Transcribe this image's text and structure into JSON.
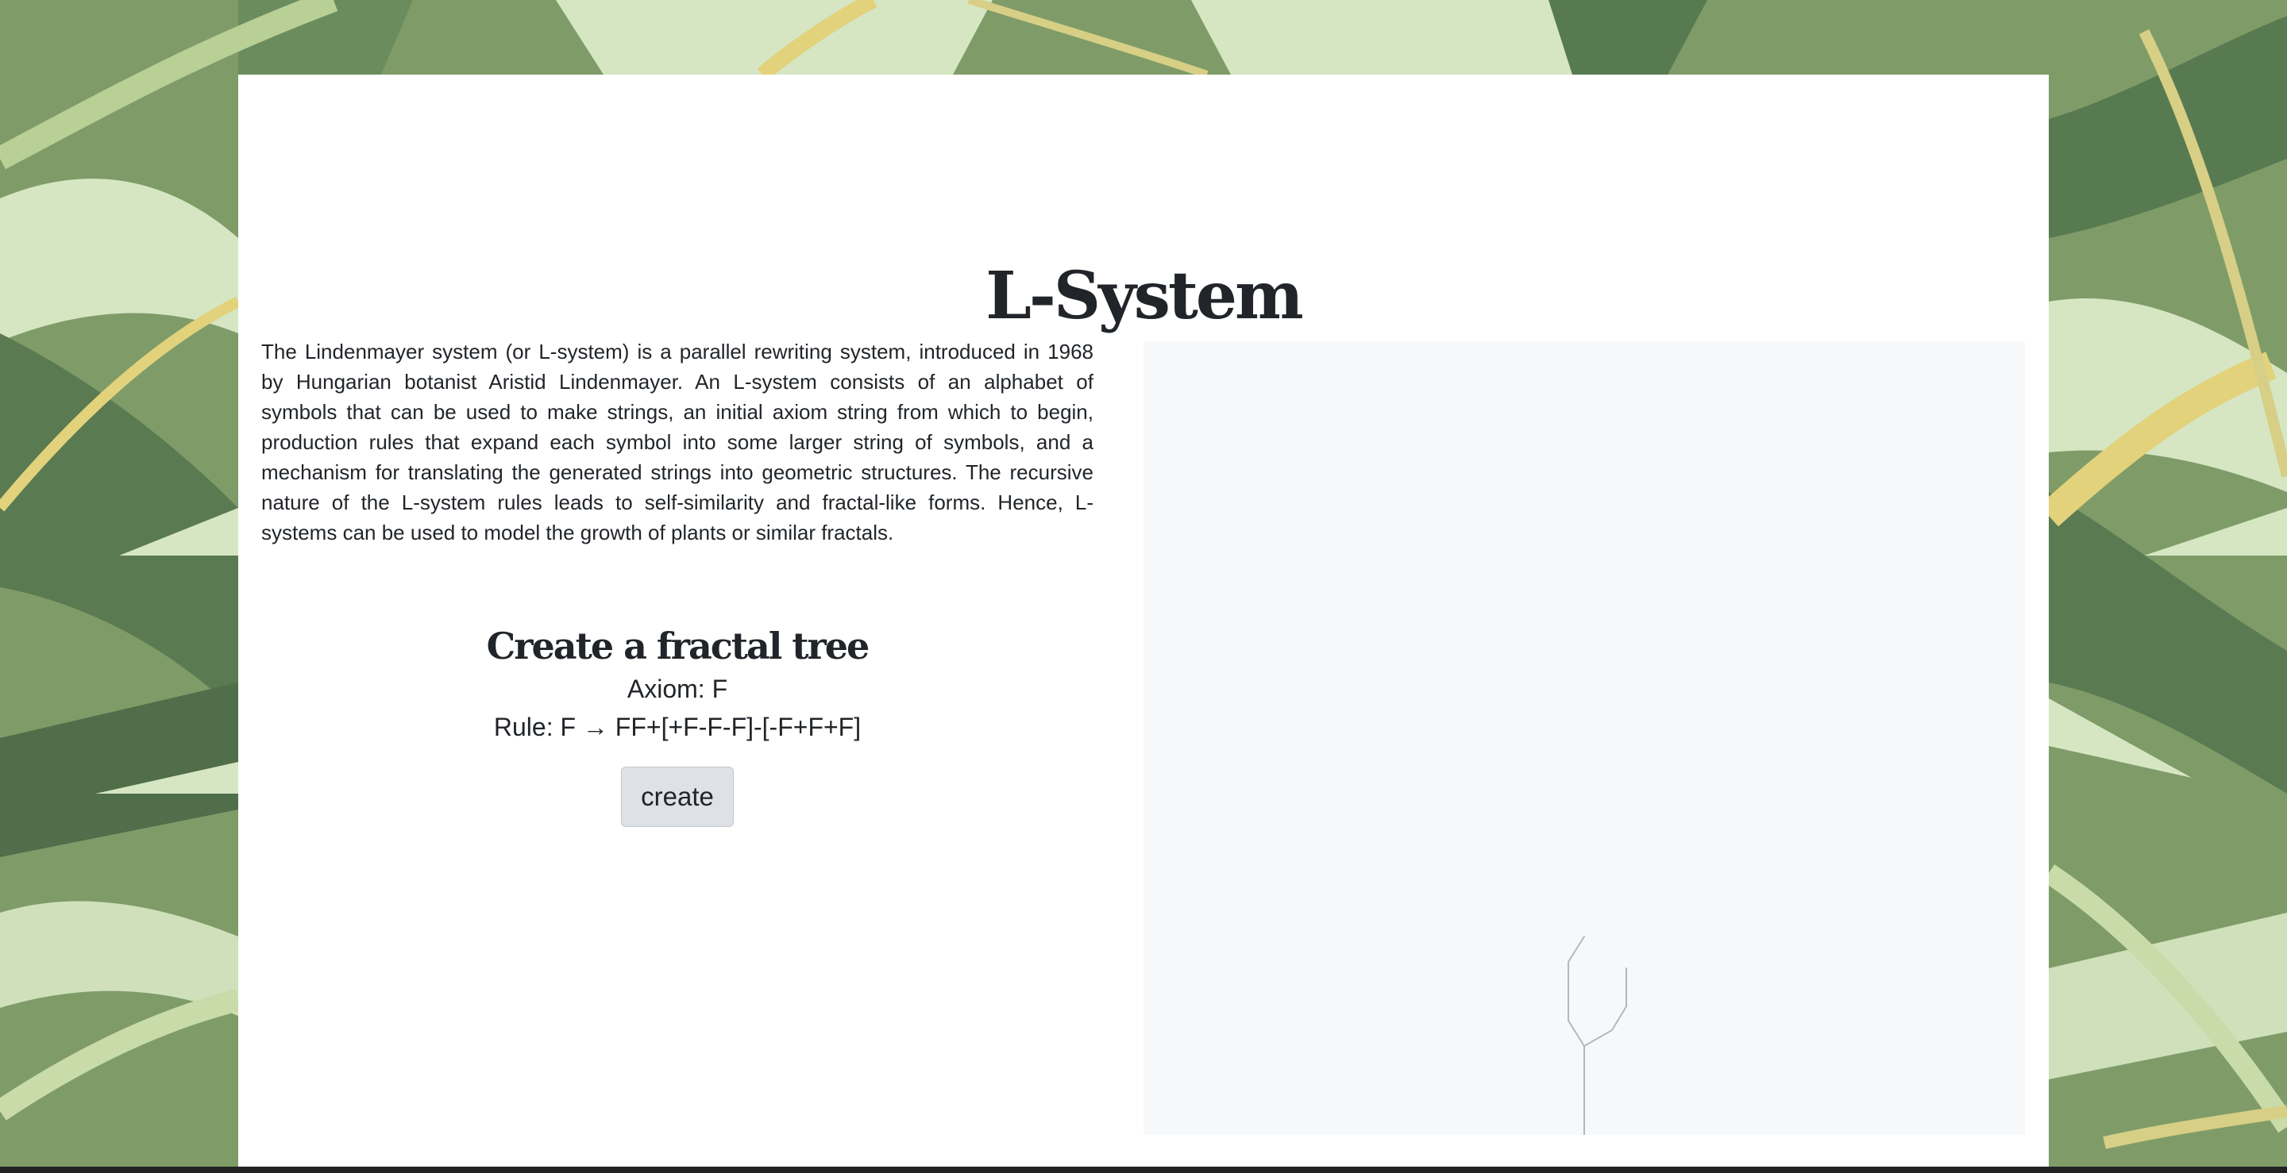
{
  "page": {
    "title": "L-System",
    "description": "The Lindenmayer system (or L-system) is a parallel rewriting system, introduced in 1968 by Hungarian botanist Aristid Lindenmayer. An L-system consists of an alphabet of symbols that can be used to make strings, an initial axiom string from which to begin, production rules that expand each symbol into some larger string of symbols, and a mechanism for translating the generated strings into geometric structures. The recursive nature of the L-system rules leads to self-similarity and fractal-like forms. Hence, L-systems can be used to model the growth of plants or similar fractals."
  },
  "generator": {
    "heading": "Create a fractal tree",
    "axiom": "Axiom: F",
    "rule": "Rule: F → FF+[+F-F-F]-[-F+F+F]",
    "button_label": "create"
  },
  "colors": {
    "card_background": "#ffffff",
    "canvas_background": "#f7f8f9",
    "tree_stroke": "#b5b8bb",
    "button_background": "#dee1e5",
    "text": "#212529"
  },
  "background": {
    "theme": "banana-leaf pattern"
  }
}
